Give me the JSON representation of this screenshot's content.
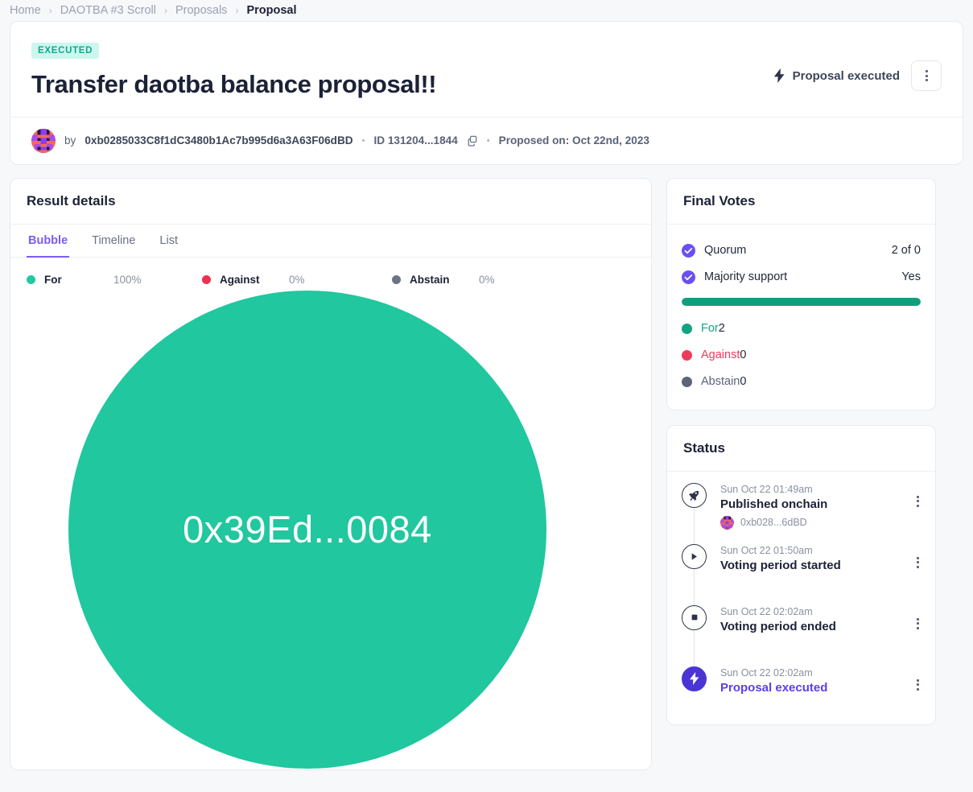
{
  "breadcrumb": {
    "items": [
      {
        "label": "Home",
        "current": false
      },
      {
        "label": "DAOTBA #3 Scroll",
        "current": false
      },
      {
        "label": "Proposals",
        "current": false
      },
      {
        "label": "Proposal",
        "current": true
      }
    ],
    "separator": "›"
  },
  "proposal": {
    "status_badge": "EXECUTED",
    "title": "Transfer daotba balance proposal!!",
    "executed_label": "Proposal executed",
    "kebab_label": "More options",
    "by_label": "by",
    "author_address": "0xb0285033C8f1dC3480b1Ac7b995d6a3A63F06dBD",
    "id_label": "ID 131204...1844",
    "proposed_on": "Proposed on: Oct 22nd, 2023",
    "separator_dot": "•"
  },
  "result_details": {
    "title": "Result details",
    "tabs": [
      {
        "label": "Bubble",
        "active": true
      },
      {
        "label": "Timeline",
        "active": false
      },
      {
        "label": "List",
        "active": false
      }
    ],
    "legend": [
      {
        "label": "For",
        "pct": "100%",
        "color": "#21c9a0"
      },
      {
        "label": "Against",
        "pct": "0%",
        "color": "#f0304f"
      },
      {
        "label": "Abstain",
        "pct": "0%",
        "color": "#6b7488"
      }
    ],
    "bubble": {
      "label": "0x39Ed...0084",
      "color": "#21c79e",
      "text_color": "#ffffff"
    }
  },
  "final_votes": {
    "title": "Final Votes",
    "checks": [
      {
        "name": "Quorum",
        "value": "2 of 0"
      },
      {
        "name": "Majority support",
        "value": "Yes"
      }
    ],
    "bar": {
      "for_pct": 100,
      "fill_color": "#129e7b",
      "track_color": "#eef0f4"
    },
    "votes": [
      {
        "name": "For",
        "count": "2",
        "color": "#12a47f"
      },
      {
        "name": "Against",
        "count": "0",
        "color": "#ef3b5b"
      },
      {
        "name": "Abstain",
        "count": "0",
        "color": "#5c6478"
      }
    ]
  },
  "status": {
    "title": "Status",
    "events": [
      {
        "time": "Sun Oct 22 01:49am",
        "title": "Published onchain",
        "icon": "rocket-icon",
        "sub_address": "0xb028...6dBD",
        "filled": false,
        "accent": false
      },
      {
        "time": "Sun Oct 22 01:50am",
        "title": "Voting period started",
        "icon": "play-icon",
        "sub_address": "",
        "filled": false,
        "accent": false
      },
      {
        "time": "Sun Oct 22 02:02am",
        "title": "Voting period ended",
        "icon": "stop-icon",
        "sub_address": "",
        "filled": false,
        "accent": false
      },
      {
        "time": "Sun Oct 22 02:02am",
        "title": "Proposal executed",
        "icon": "bolt-icon",
        "sub_address": "",
        "filled": true,
        "accent": true
      }
    ]
  },
  "chart_data": {
    "type": "bubble",
    "title": "Result details",
    "categories": [
      "For",
      "Against",
      "Abstain"
    ],
    "values": [
      100,
      0,
      0
    ],
    "unit": "%",
    "bubbles": [
      {
        "label": "0x39Ed...0084",
        "choice": "For",
        "share": 100,
        "votes": 2
      }
    ],
    "legend_position": "top"
  }
}
